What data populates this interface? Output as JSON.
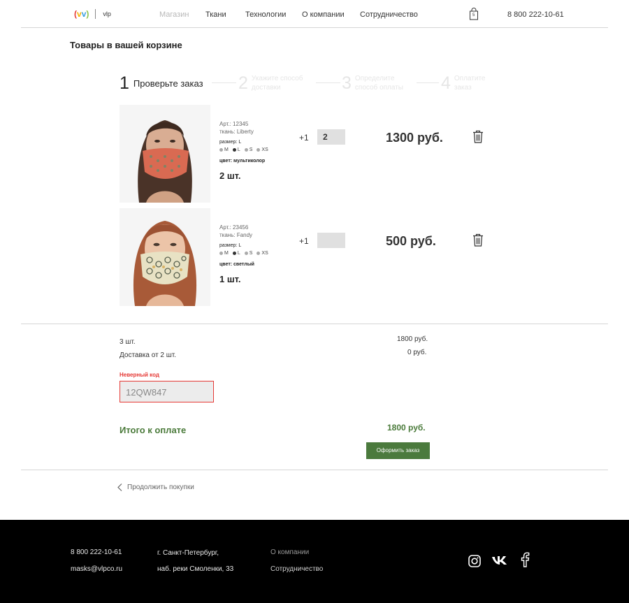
{
  "header": {
    "logo_text": "vlp",
    "nav": [
      "Магазин",
      "Ткани",
      "Технологии",
      "О компании",
      "Сотрудничество"
    ],
    "cart_count": "5",
    "phone": "8 800 222-10-61"
  },
  "page_title": "Товары в вашей корзине",
  "steps": [
    {
      "num": "1",
      "label": "Проверьте заказ"
    },
    {
      "num": "2",
      "label": "Укажите способ доставки"
    },
    {
      "num": "3",
      "label": "Определите способ оплаты"
    },
    {
      "num": "4",
      "label": "Оплатите заказ"
    }
  ],
  "items": [
    {
      "art": "Арт.: 12345",
      "fabric": "ткань: Liberty",
      "size": "размер: L",
      "sizes": [
        "M",
        "L",
        "S",
        "XS"
      ],
      "selected_size": "L",
      "color": "цвет: мультиколор",
      "qty_text": "2 шт.",
      "plus": "+1",
      "qty_value": "2",
      "price": "1300 руб."
    },
    {
      "art": "Арт.: 23456",
      "fabric": "ткань: Fandy",
      "size": "размер: L",
      "sizes": [
        "M",
        "L",
        "S",
        "XS"
      ],
      "selected_size": "L",
      "color": "цвет: светлый",
      "qty_text": "1 шт.",
      "plus": "+1",
      "qty_value": "",
      "price": "500 руб."
    }
  ],
  "summary": {
    "count_label": "3 шт.",
    "count_sum": "1800 руб.",
    "delivery_label": "Доставка от 2 шт.",
    "delivery_sum": "0 руб.",
    "error_label": "Неверный код",
    "promo_value": "12QW847",
    "total_label": "Итого к оплате",
    "total_sum": "1800 руб.",
    "order_button": "Оформить заказ",
    "continue_label": "Продолжить покупки"
  },
  "footer": {
    "phone": "8 800 222-10-61",
    "email": "masks@vlpco.ru",
    "address_line1": "г. Санкт-Петербург,",
    "address_line2": "наб. реки Смоленки, 33",
    "link_about": "О компании",
    "link_coop": "Сотрудничество"
  },
  "colors": {
    "accent_green": "#4b7a3d",
    "error_red": "#e53935",
    "footer_bg": "#000000"
  }
}
